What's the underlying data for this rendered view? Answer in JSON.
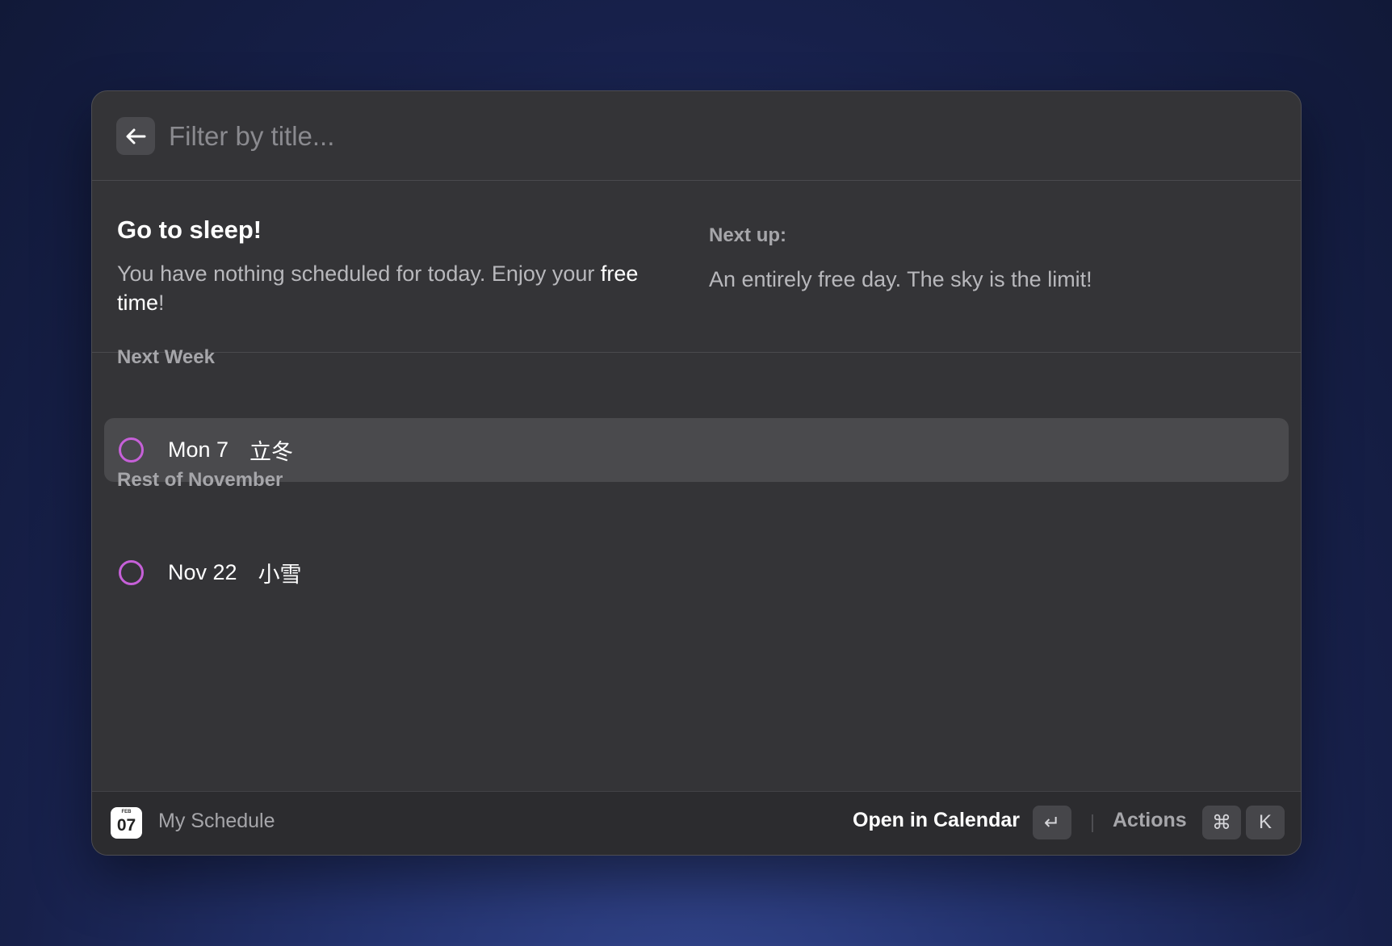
{
  "search": {
    "placeholder": "Filter by title...",
    "value": ""
  },
  "detail": {
    "title": "Go to sleep!",
    "text_before": "You have nothing scheduled for today. Enjoy your ",
    "text_highlight": "free time",
    "text_after": "!",
    "next_up_label": "Next up:",
    "next_up_text": "An entirely free day. The sky is the limit!"
  },
  "sections": [
    {
      "title": "Next Week",
      "items": [
        {
          "date": "Mon 7",
          "title": "立冬",
          "color": "#c660d8",
          "selected": true
        }
      ]
    },
    {
      "title": "Rest of November",
      "items": [
        {
          "date": "Nov 22",
          "title": "小雪",
          "color": "#c660d8",
          "selected": false
        }
      ]
    }
  ],
  "footer": {
    "app_icon": {
      "month": "FEB",
      "day": "07"
    },
    "app_name": "My Schedule",
    "primary_action": "Open in Calendar",
    "primary_shortcut": "↵",
    "actions_label": "Actions",
    "actions_shortcut": [
      "⌘",
      "K"
    ]
  },
  "icons": {
    "back": "arrow-left-icon",
    "item_status": "circle-outline-icon",
    "app": "calendar-icon"
  }
}
